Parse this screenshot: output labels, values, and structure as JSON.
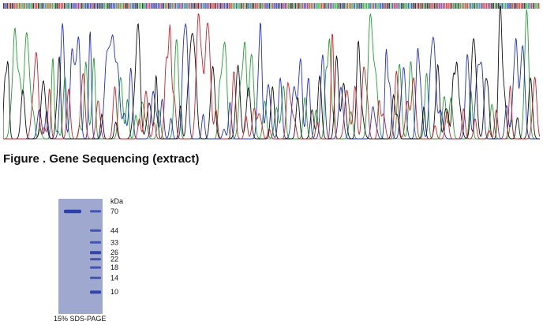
{
  "chromatogram": {
    "seed": 7,
    "trace_colors": {
      "A": "#1fa12f",
      "C": "#1f2fd0",
      "G": "#111111",
      "T": "#d0202a"
    }
  },
  "figure_caption": "Figure . Gene Sequencing (extract)",
  "gel": {
    "unit_label": "kDa",
    "caption": "15% SDS-PAGE",
    "gel_color": "#9fa9cf",
    "band_color": "#2c3fa8",
    "markers": [
      {
        "label": "70",
        "value": 70
      },
      {
        "label": "44",
        "value": 44
      },
      {
        "label": "33",
        "value": 33
      },
      {
        "label": "26",
        "value": 26
      },
      {
        "label": "22",
        "value": 22
      },
      {
        "label": "18",
        "value": 18
      },
      {
        "label": "14",
        "value": 14
      },
      {
        "label": "10",
        "value": 10
      }
    ],
    "sample_band_kda": 70
  }
}
